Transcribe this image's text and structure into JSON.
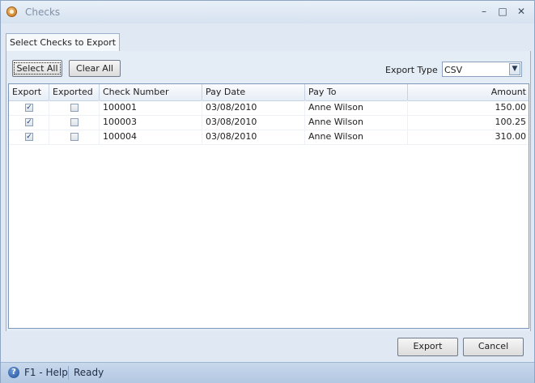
{
  "window": {
    "title": "Checks",
    "minimize_glyph": "–",
    "maximize_glyph": "□",
    "close_glyph": "✕"
  },
  "tab": {
    "label": "Select Checks to Export"
  },
  "toolbar": {
    "select_all_label": "Select All",
    "clear_all_label": "Clear All",
    "export_type_label": "Export Type",
    "export_type_value": "CSV"
  },
  "grid": {
    "columns": [
      "Export",
      "Exported",
      "Check Number",
      "Pay Date",
      "Pay To",
      "Amount"
    ],
    "rows": [
      {
        "export": true,
        "exported": false,
        "check_number": "100001",
        "pay_date": "03/08/2010",
        "pay_to": "Anne Wilson",
        "amount": "150.00"
      },
      {
        "export": true,
        "exported": false,
        "check_number": "100003",
        "pay_date": "03/08/2010",
        "pay_to": "Anne Wilson",
        "amount": "100.25"
      },
      {
        "export": true,
        "exported": false,
        "check_number": "100004",
        "pay_date": "03/08/2010",
        "pay_to": "Anne Wilson",
        "amount": "310.00"
      }
    ]
  },
  "footer": {
    "export_label": "Export",
    "cancel_label": "Cancel"
  },
  "status": {
    "help_label": "F1 - Help",
    "state": "Ready"
  },
  "icons": {
    "app": "checks-app-icon",
    "help": "help-icon",
    "dropdown": "chevron-down-icon",
    "checkbox_checked": "checkmark-icon"
  },
  "colors": {
    "window_bg": "#dfe8f3",
    "grid_border": "#7f97b8",
    "status_bar": "#b3c8e2"
  }
}
